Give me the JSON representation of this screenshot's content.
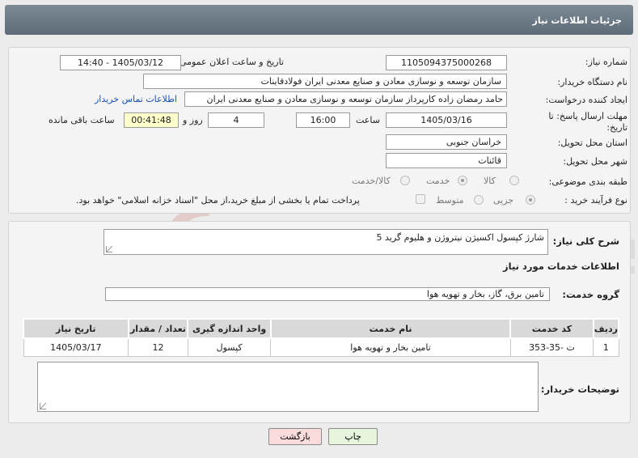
{
  "header": {
    "title": "جزئیات اطلاعات نیاز"
  },
  "form": {
    "need_number_label": "شماره نیاز:",
    "need_number": "1105094375000268",
    "announce_label": "تاریخ و ساعت اعلان عمومی:",
    "announce_value": "1405/03/12 - 14:40",
    "buyer_org_label": "نام دستگاه خریدار:",
    "buyer_org": "سازمان توسعه و نوسازی معادن و صنایع معدنی ایران فولادقاینات",
    "requester_label": "ایجاد کننده درخواست:",
    "requester": "حامد  رمضان زاده  کارپرداز  سازمان توسعه و نوسازی معادن و صنایع معدنی ایران",
    "contact_link": "اطلاعات تماس خریدار",
    "deadline_label": "مهلت ارسال پاسخ: تا تاریخ:",
    "deadline_date": "1405/03/16",
    "time_label": "ساعت",
    "deadline_time": "16:00",
    "days_value": "4",
    "days_label": "روز و",
    "remaining_time": "00:41:48",
    "remaining_label": "ساعت باقی مانده",
    "province_label": "استان محل تحویل:",
    "province": "خراسان جنوبی",
    "city_label": "شهر محل تحویل:",
    "city": "قائنات",
    "category_label": "طبقه بندی موضوعی:",
    "category_options": {
      "goods": "کالا",
      "service": "خدمت",
      "goods_service": "کالا/خدمت"
    },
    "process_label": "نوع فرآیند خرید :",
    "process_options": {
      "minor": "جزیی",
      "medium": "متوسط"
    },
    "payment_note": "پرداخت تمام یا بخشی از مبلغ خرید،از محل \"اسناد خزانه اسلامی\" خواهد بود."
  },
  "details": {
    "summary_label": "شرح کلی نیاز:",
    "summary": "شارژ کپسول اکسیژن نیتروژن و هلیوم گرید 5",
    "services_title": "اطلاعات خدمات مورد نیاز",
    "service_group_label": "گروه خدمت:",
    "service_group": "تامین برق، گاز، بخار و تهویه هوا",
    "table": {
      "headers": [
        "ردیف",
        "کد خدمت",
        "نام خدمت",
        "واحد اندازه گیری",
        "تعداد / مقدار",
        "تاریخ نیاز"
      ],
      "rows": [
        [
          "1",
          "ت -35-353",
          "تامین بخار و تهویه هوا",
          "کپسول",
          "12",
          "1405/03/17"
        ]
      ]
    },
    "buyer_notes_label": "توضیحات خریدار:"
  },
  "buttons": {
    "print": "چاپ",
    "back": "بازگشت"
  },
  "watermark": {
    "text": "AriaTender.net"
  }
}
